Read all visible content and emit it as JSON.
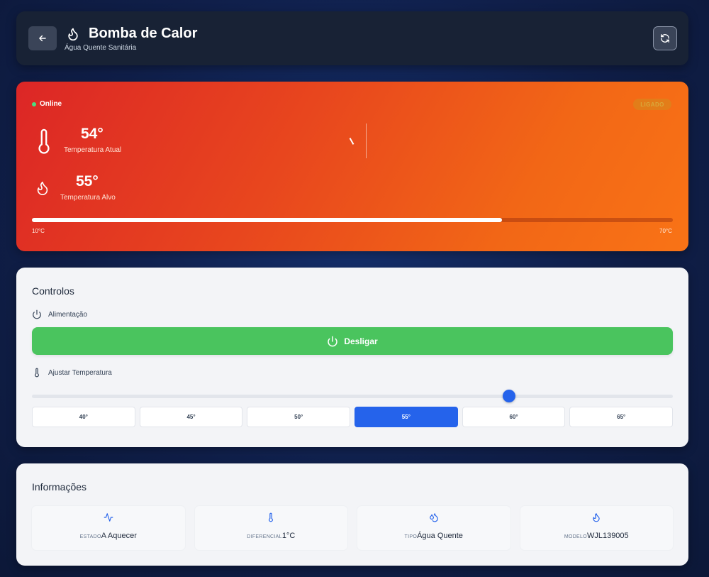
{
  "header": {
    "title": "Bomba de Calor",
    "subtitle": "Água Quente Sanitária",
    "back_icon": "arrow-left-icon",
    "title_icon": "flame-icon",
    "refresh_icon": "refresh-icon"
  },
  "status": {
    "online_label": "Online",
    "state_badge": "LIGADO",
    "current_temp": "54°",
    "current_label": "Temperatura Atual",
    "target_temp": "55°",
    "target_label": "Temperatura Alvo",
    "range_min": "10°C",
    "range_max": "70°C",
    "range_fill_fraction": 0.733,
    "colors": {
      "gradient_start": "#dc2626",
      "gradient_end": "#f97316",
      "online": "#4ade80"
    }
  },
  "controls": {
    "title": "Controlos",
    "power_label": "Alimentação",
    "power_button": "Desligar",
    "temp_label": "Ajustar Temperatura",
    "slider_fraction": 0.745,
    "presets": [
      "40°",
      "45°",
      "50°",
      "55°",
      "60°",
      "65°"
    ],
    "active_preset": "55°",
    "colors": {
      "power_button": "#4ac45e",
      "accent": "#2563eb"
    }
  },
  "info": {
    "title": "Informações",
    "items": [
      {
        "key": "ESTADO",
        "value": "A Aquecer",
        "icon": "activity-icon"
      },
      {
        "key": "DIFERENCIAL",
        "value": "1°C",
        "icon": "thermometer-icon"
      },
      {
        "key": "TIPO",
        "value": "Água Quente",
        "icon": "droplets-icon"
      },
      {
        "key": "MODELO",
        "value": "WJL139005",
        "icon": "flame-icon"
      }
    ]
  }
}
